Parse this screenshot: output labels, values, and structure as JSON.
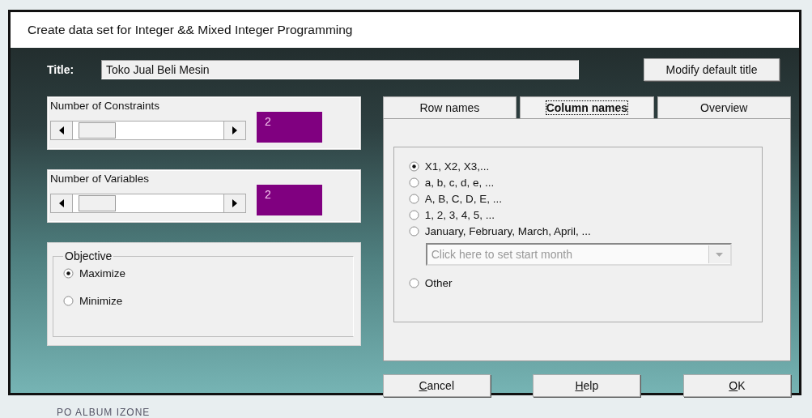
{
  "window": {
    "title": "Create data set for Integer && Mixed Integer Programming"
  },
  "title_field": {
    "label": "Title:",
    "value": "Toko Jual Beli Mesin"
  },
  "modify_button": "Modify default title",
  "spinners": [
    {
      "label": "Number of Constraints",
      "level": 0.05,
      "value": "2"
    },
    {
      "label": "Number of Variables",
      "level": 0.05,
      "value": "2"
    }
  ],
  "objective": {
    "label": "Objective",
    "options": [
      {
        "label": "Maximize",
        "selected": true
      },
      {
        "label": "Minimize",
        "selected": false
      }
    ]
  },
  "tabs": [
    {
      "label": "Row names",
      "selected": false
    },
    {
      "label": "Column names",
      "selected": true
    },
    {
      "label": "Overview",
      "selected": false
    }
  ],
  "column_name_options": [
    {
      "kind": "radio",
      "label": "X1, X2, X3,...",
      "selected": true
    },
    {
      "kind": "radio",
      "label": "a, b, c, d, e, ...",
      "selected": false
    },
    {
      "kind": "radio",
      "label": "A, B, C, D, E, ...",
      "selected": false
    },
    {
      "kind": "radio",
      "label": "1, 2, 3, 4, 5, ...",
      "selected": false
    },
    {
      "kind": "radio",
      "label": "January, February, March, April, ...",
      "selected": false
    },
    {
      "kind": "dropdown",
      "placeholder": "Click here to set start month",
      "disabled": true
    },
    {
      "kind": "radio",
      "label": "Other",
      "selected": false
    }
  ],
  "buttons": [
    "Cancel",
    "Help",
    "OK"
  ],
  "background": {
    "text": "PO ALBUM IZONE"
  }
}
